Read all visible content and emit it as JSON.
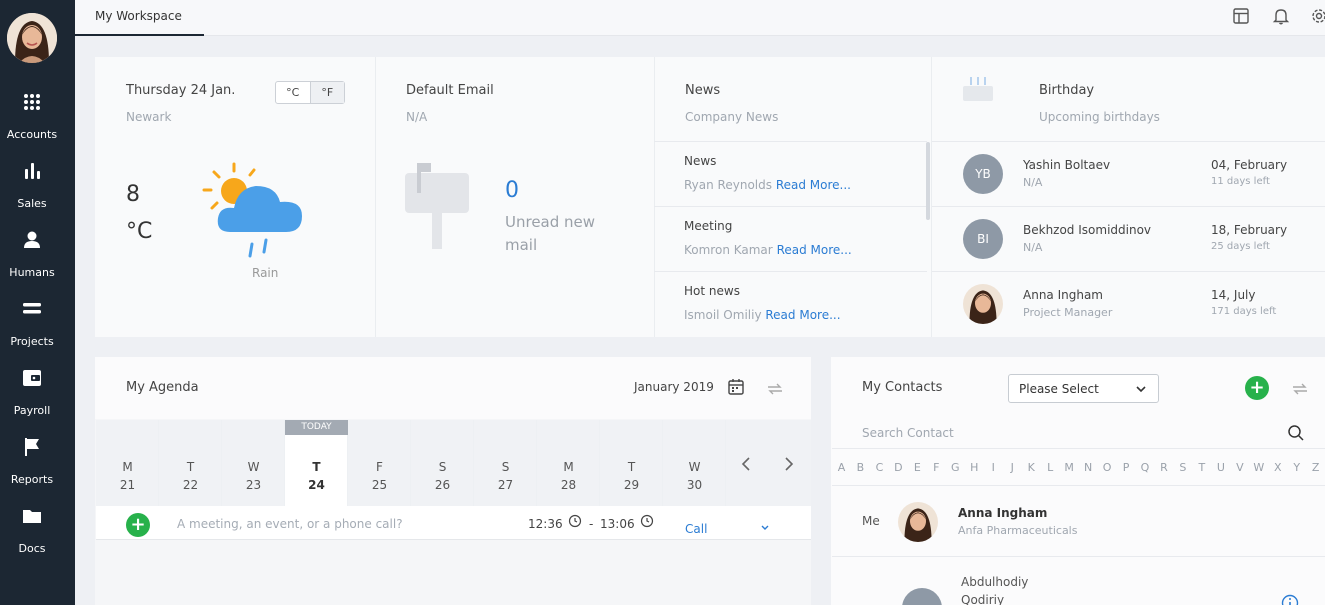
{
  "sidebar": {
    "items": [
      {
        "label": "Accounts",
        "icon": "grid-icon"
      },
      {
        "label": "Sales",
        "icon": "bar-chart-icon"
      },
      {
        "label": "Humans",
        "icon": "user-icon"
      },
      {
        "label": "Projects",
        "icon": "list-icon"
      },
      {
        "label": "Payroll",
        "icon": "wallet-icon"
      },
      {
        "label": "Reports",
        "icon": "flag-icon"
      },
      {
        "label": "Docs",
        "icon": "folder-icon"
      }
    ]
  },
  "topbar": {
    "tab": "My Workspace"
  },
  "weather": {
    "date": "Thursday 24 Jan.",
    "city": "Newark",
    "unit_c": "°C",
    "unit_f": "°F",
    "temp": "8",
    "temp_unit": "°C",
    "condition": "Rain"
  },
  "email": {
    "title": "Default Email",
    "value": "N/A",
    "count": "0",
    "label": "Unread new mail"
  },
  "news": {
    "title": "News",
    "subtitle": "Company News",
    "read_more": "Read More...",
    "items": [
      {
        "title": "News",
        "author": "Ryan Reynolds"
      },
      {
        "title": "Meeting",
        "author": "Komron Kamar"
      },
      {
        "title": "Hot news",
        "author": "Ismoil Omiliy"
      }
    ]
  },
  "birthday": {
    "title": "Birthday",
    "subtitle": "Upcoming birthdays",
    "items": [
      {
        "initials": "YB",
        "name": "Yashin Boltaev",
        "role": "N/A",
        "date": "04, February",
        "left": "11 days left"
      },
      {
        "initials": "BI",
        "name": "Bekhzod Isomiddinov",
        "role": "N/A",
        "date": "18, February",
        "left": "25 days left"
      },
      {
        "initials": "",
        "name": "Anna Ingham",
        "role": "Project Manager",
        "date": "14, July",
        "left": "171 days left"
      }
    ]
  },
  "agenda": {
    "title": "My Agenda",
    "month": "January 2019",
    "today_badge": "TODAY",
    "days": [
      {
        "d": "M",
        "n": "21"
      },
      {
        "d": "T",
        "n": "22"
      },
      {
        "d": "W",
        "n": "23"
      },
      {
        "d": "T",
        "n": "24"
      },
      {
        "d": "F",
        "n": "25"
      },
      {
        "d": "S",
        "n": "26"
      },
      {
        "d": "S",
        "n": "27"
      },
      {
        "d": "M",
        "n": "28"
      },
      {
        "d": "T",
        "n": "29"
      },
      {
        "d": "W",
        "n": "30"
      }
    ],
    "placeholder": "A meeting, an event, or a phone call?",
    "time_from": "12:36",
    "time_sep": "-",
    "time_to": "13:06",
    "type": "Call"
  },
  "contacts": {
    "title": "My Contacts",
    "select": "Please Select",
    "search_placeholder": "Search Contact",
    "letters": [
      "A",
      "B",
      "C",
      "D",
      "E",
      "F",
      "G",
      "H",
      "I",
      "J",
      "K",
      "L",
      "M",
      "N",
      "O",
      "P",
      "Q",
      "R",
      "S",
      "T",
      "U",
      "V",
      "W",
      "X",
      "Y",
      "Z"
    ],
    "me_label": "Me",
    "me_name": "Anna Ingham",
    "me_company": "Anfa Pharmaceuticals",
    "next_name_1": "Abdulhodiy",
    "next_name_2": "Qodiriy"
  }
}
